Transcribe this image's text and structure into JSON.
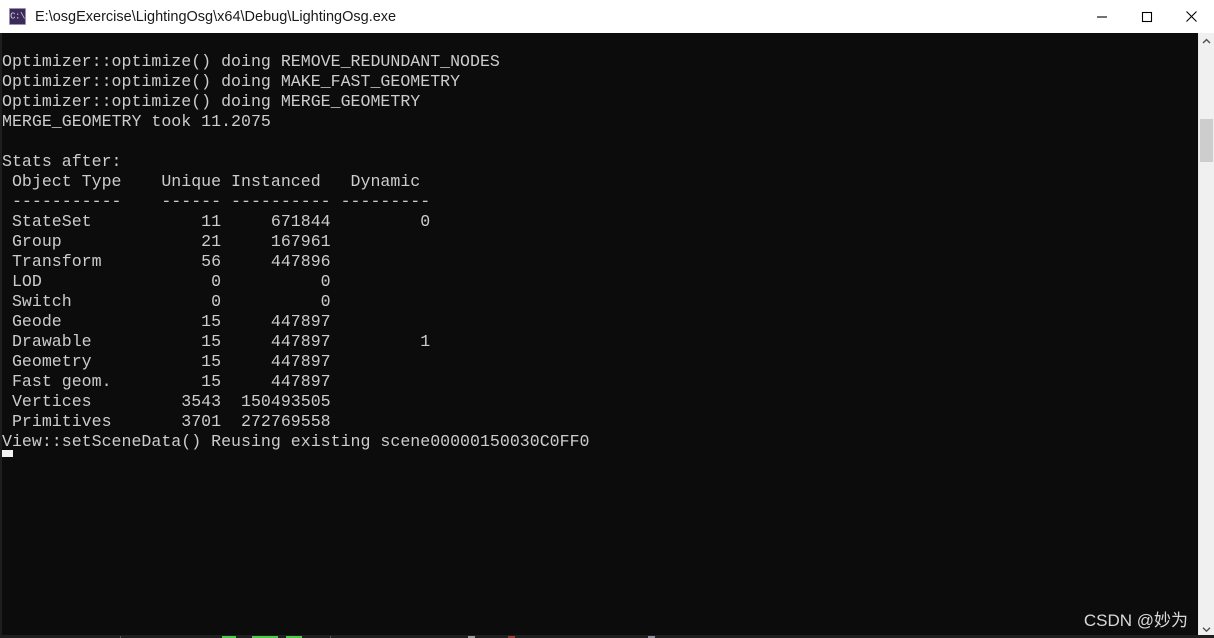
{
  "window": {
    "title": "E:\\osgExercise\\LightingOsg\\x64\\Debug\\LightingOsg.exe",
    "icon_name": "console-app-icon",
    "icon_glyph": "C:\\",
    "background_color": "#0c0c0c",
    "titlebar_background_color": "#ffffff",
    "text_color": "#cccccc"
  },
  "titlebar_buttons": {
    "minimize_label": "Minimize",
    "maximize_label": "Maximize",
    "close_label": "Close"
  },
  "console": {
    "lines": [
      "Optimizer::optimize() doing REMOVE_REDUNDANT_NODES",
      "Optimizer::optimize() doing MAKE_FAST_GEOMETRY",
      "Optimizer::optimize() doing MERGE_GEOMETRY",
      "MERGE_GEOMETRY took 11.2075",
      "",
      "Stats after:",
      " Object Type    Unique Instanced   Dynamic",
      " -----------    ------ ---------- ---------",
      " StateSet           11     671844         0",
      " Group              21     167961",
      " Transform          56     447896",
      " LOD                 0          0",
      " Switch              0          0",
      " Geode              15     447897",
      " Drawable           15     447897         1",
      " Geometry           15     447897",
      " Fast geom.         15     447897",
      " Vertices         3543  150493505",
      " Primitives       3701  272769558",
      "View::setSceneData() Reusing existing scene00000150030C0FF0"
    ],
    "stats_table": {
      "caption": "Stats after:",
      "columns": [
        "Object Type",
        "Unique",
        "Instanced",
        "Dynamic"
      ],
      "rows": [
        [
          "StateSet",
          "11",
          "671844",
          "0"
        ],
        [
          "Group",
          "21",
          "167961",
          ""
        ],
        [
          "Transform",
          "56",
          "447896",
          ""
        ],
        [
          "LOD",
          "0",
          "0",
          ""
        ],
        [
          "Switch",
          "0",
          "0",
          ""
        ],
        [
          "Geode",
          "15",
          "447897",
          ""
        ],
        [
          "Drawable",
          "15",
          "447897",
          "1"
        ],
        [
          "Geometry",
          "15",
          "447897",
          ""
        ],
        [
          "Fast geom.",
          "15",
          "447897",
          ""
        ],
        [
          "Vertices",
          "3543",
          "150493505",
          ""
        ],
        [
          "Primitives",
          "3701",
          "272769558",
          ""
        ]
      ]
    },
    "messages": [
      "Optimizer::optimize() doing REMOVE_REDUNDANT_NODES",
      "Optimizer::optimize() doing MAKE_FAST_GEOMETRY",
      "Optimizer::optimize() doing MERGE_GEOMETRY",
      "MERGE_GEOMETRY took 11.2075",
      "View::setSceneData() Reusing existing scene00000150030C0FF0"
    ],
    "merge_geometry_time": "11.2075",
    "scene_pointer": "00000150030C0FF0",
    "cursor_name": "text-cursor"
  },
  "scrollbar": {
    "up_arrow_name": "scroll-up-arrow",
    "down_arrow_name": "scroll-down-arrow",
    "track_color": "#f0f0f0",
    "thumb_color": "#cdcdcd"
  },
  "watermark": {
    "text": "CSDN @妙为"
  }
}
